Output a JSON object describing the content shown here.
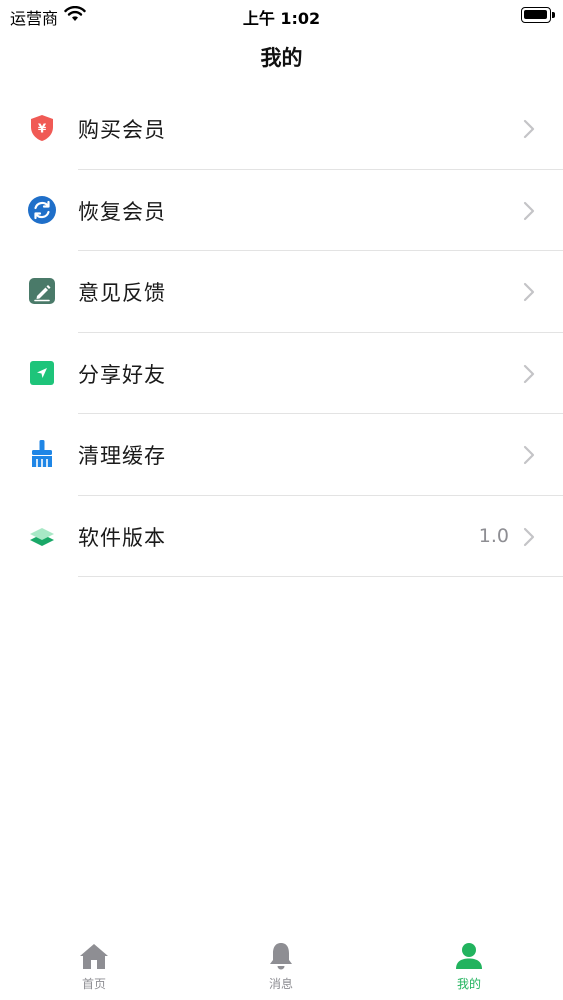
{
  "status_bar": {
    "carrier": "运营商",
    "time": "上午 1:02"
  },
  "nav": {
    "title": "我的"
  },
  "menu": {
    "items": [
      {
        "label": "购买会员",
        "icon": "shield-yen-icon",
        "value": ""
      },
      {
        "label": "恢复会员",
        "icon": "refresh-icon",
        "value": ""
      },
      {
        "label": "意见反馈",
        "icon": "edit-pencil-icon",
        "value": ""
      },
      {
        "label": "分享好友",
        "icon": "share-arrow-icon",
        "value": ""
      },
      {
        "label": "清理缓存",
        "icon": "broom-icon",
        "value": ""
      },
      {
        "label": "软件版本",
        "icon": "layers-icon",
        "value": "1.0"
      }
    ]
  },
  "tab_bar": {
    "tabs": [
      {
        "label": "首页",
        "icon": "home-icon",
        "active": false
      },
      {
        "label": "消息",
        "icon": "bell-icon",
        "active": false
      },
      {
        "label": "我的",
        "icon": "person-icon",
        "active": true
      }
    ]
  },
  "colors": {
    "accent": "#22b35e",
    "inactive": "#8e8e93",
    "shield": "#f05a55",
    "refresh": "#1f6fc9",
    "feedback": "#4a7a69",
    "share": "#1ec47a",
    "broom": "#1f86e6",
    "layers": "#3cc48a"
  }
}
